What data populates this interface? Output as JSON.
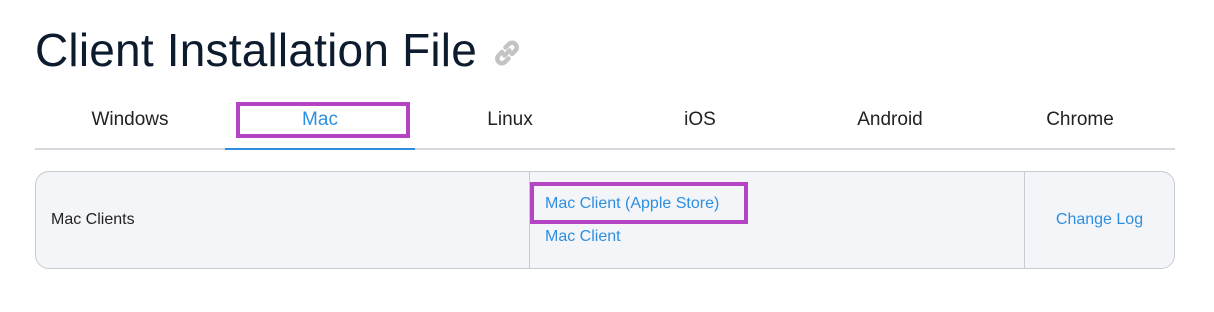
{
  "page": {
    "title": "Client Installation File",
    "title_icon": "link-icon"
  },
  "tabs": [
    {
      "label": "Windows",
      "active": false
    },
    {
      "label": "Mac",
      "active": true
    },
    {
      "label": "Linux",
      "active": false
    },
    {
      "label": "iOS",
      "active": false
    },
    {
      "label": "Android",
      "active": false
    },
    {
      "label": "Chrome",
      "active": false
    }
  ],
  "table": {
    "row_label": "Mac Clients",
    "links": [
      {
        "label": "Mac Client (Apple Store)"
      },
      {
        "label": "Mac Client"
      }
    ],
    "change_log_label": "Change Log"
  },
  "colors": {
    "accent": "#2d8fe0",
    "highlight": "#b444c4",
    "title": "#0d1b2e",
    "table_bg": "#f4f5f9",
    "border": "#c7ccd3"
  }
}
